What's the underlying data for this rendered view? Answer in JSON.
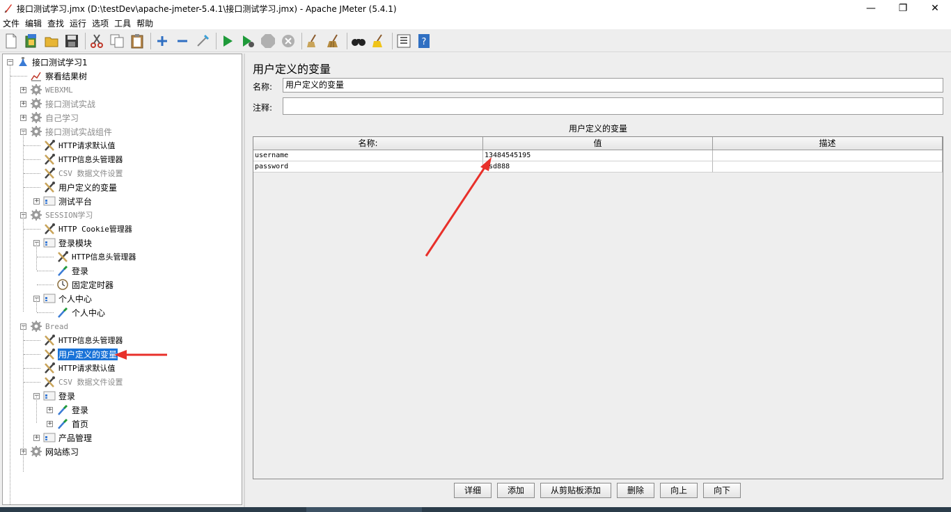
{
  "window": {
    "title": "接口测试学习.jmx (D:\\testDev\\apache-jmeter-5.4.1\\接口测试学习.jmx) - Apache JMeter (5.4.1)",
    "minimize": "—",
    "restore": "❐",
    "close": "✕"
  },
  "menu": [
    "文件",
    "编辑",
    "查找",
    "运行",
    "选项",
    "工具",
    "帮助"
  ],
  "tree": [
    {
      "label": "接口测试学习1",
      "icon": "test-plan-icon",
      "dim": false
    },
    {
      "label": "察看结果树",
      "icon": "results-tree-icon",
      "dim": false
    },
    {
      "label": "WEBXML",
      "icon": "thread-group-gear-icon",
      "dim": true
    },
    {
      "label": "接口测试实战",
      "icon": "thread-group-gear-icon",
      "dim": true
    },
    {
      "label": "自己学习",
      "icon": "thread-group-gear-icon",
      "dim": true
    },
    {
      "label": "接口测试实战组件",
      "icon": "thread-group-gear-icon",
      "dim": true
    },
    {
      "label": "HTTP请求默认值",
      "icon": "config-wrench-icon",
      "dim": false
    },
    {
      "label": "HTTP信息头管理器",
      "icon": "config-wrench-icon",
      "dim": false
    },
    {
      "label": "CSV 数据文件设置",
      "icon": "config-wrench-icon",
      "dim": true
    },
    {
      "label": "用户定义的变量",
      "icon": "config-wrench-icon",
      "dim": false
    },
    {
      "label": "测试平台",
      "icon": "controller-icon",
      "dim": false
    },
    {
      "label": "SESSION学习",
      "icon": "thread-group-gear-icon",
      "dim": true
    },
    {
      "label": "HTTP Cookie管理器",
      "icon": "config-wrench-icon",
      "dim": false
    },
    {
      "label": "登录模块",
      "icon": "controller-icon",
      "dim": false
    },
    {
      "label": "HTTP信息头管理器",
      "icon": "config-wrench-icon",
      "dim": false
    },
    {
      "label": "登录",
      "icon": "sampler-pipette-icon",
      "dim": false
    },
    {
      "label": "固定定时器",
      "icon": "timer-clock-icon",
      "dim": false
    },
    {
      "label": "个人中心",
      "icon": "controller-icon",
      "dim": false
    },
    {
      "label": "个人中心",
      "icon": "sampler-pipette-icon",
      "dim": false
    },
    {
      "label": "Bread",
      "icon": "thread-group-gear-icon",
      "dim": true
    },
    {
      "label": "HTTP信息头管理器",
      "icon": "config-wrench-icon",
      "dim": false
    },
    {
      "label": "用户定义的变量",
      "icon": "config-wrench-icon",
      "dim": false
    },
    {
      "label": "HTTP请求默认值",
      "icon": "config-wrench-icon",
      "dim": false
    },
    {
      "label": "CSV 数据文件设置",
      "icon": "config-wrench-icon",
      "dim": true
    },
    {
      "label": "登录",
      "icon": "controller-icon",
      "dim": false
    },
    {
      "label": "登录",
      "icon": "sampler-pipette-icon",
      "dim": false
    },
    {
      "label": "首页",
      "icon": "sampler-pipette-icon",
      "dim": false
    },
    {
      "label": "产品管理",
      "icon": "controller-icon",
      "dim": false
    },
    {
      "label": "网站练习",
      "icon": "thread-group-gear-icon",
      "dim": false
    }
  ],
  "panel": {
    "title": "用户定义的变量",
    "name_label": "名称:",
    "name_value": "用户定义的变量",
    "comment_label": "注释:",
    "comment_value": "",
    "table_caption": "用户定义的变量",
    "columns": [
      "名称:",
      "值",
      "描述"
    ],
    "rows": [
      [
        "username",
        "13484545195",
        ""
      ],
      [
        "password",
        "asd888",
        ""
      ]
    ],
    "buttons": [
      "详细",
      "添加",
      "从剪贴板添加",
      "删除",
      "向上",
      "向下"
    ]
  },
  "colors": {
    "selection": "#1a73d8",
    "annotation_arrow": "#e8302a"
  }
}
